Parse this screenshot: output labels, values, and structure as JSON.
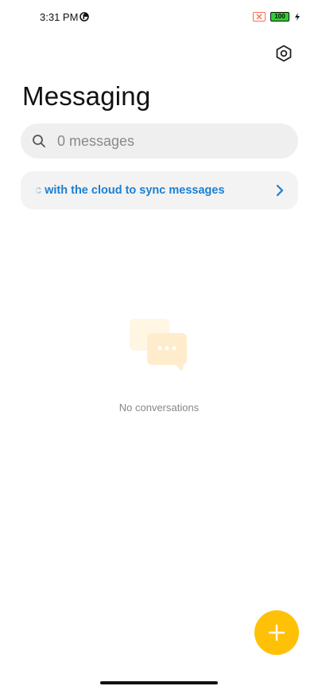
{
  "status_bar": {
    "time": "3:31 PM",
    "battery_level": "100"
  },
  "header": {
    "title": "Messaging",
    "settings_icon": "hexagon-gear-icon"
  },
  "search": {
    "placeholder": "0 messages",
    "icon": "search-icon"
  },
  "cloud_banner": {
    "text": "c with the cloud to sync messages",
    "icon": "chevron-right-icon"
  },
  "empty_state": {
    "text": "No conversations",
    "icon": "chat-bubbles-icon"
  },
  "fab": {
    "icon": "plus-icon"
  },
  "colors": {
    "accent": "#ffc107",
    "link": "#1a7fd6",
    "search_bg": "#efefef",
    "banner_bg": "#f3f3f3",
    "muted_text": "#888888"
  }
}
